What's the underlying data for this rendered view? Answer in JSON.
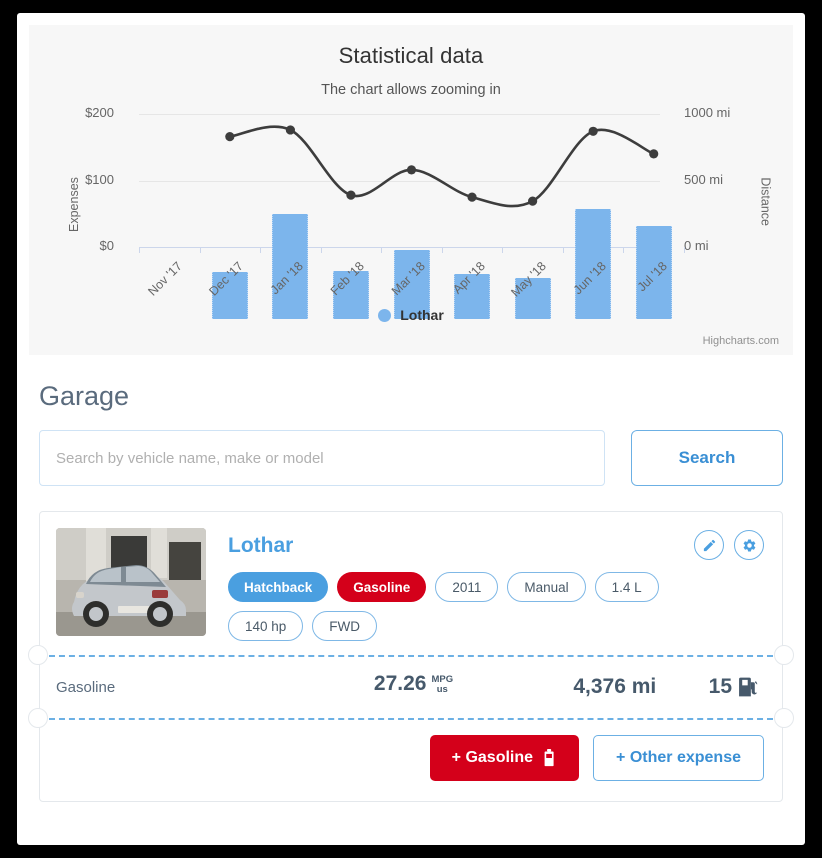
{
  "chart": {
    "title": "Statistical data",
    "subtitle": "The chart allows zooming in",
    "credit": "Highcharts.com",
    "legend_label": "Lothar"
  },
  "chart_data": {
    "type": "bar",
    "title": "Statistical data",
    "subtitle": "The chart allows zooming in",
    "categories": [
      "Nov '17",
      "Dec '17",
      "Jan '18",
      "Feb '18",
      "Mar '18",
      "Apr '18",
      "May '18",
      "Jun '18",
      "Jul '18"
    ],
    "xlabel": "",
    "ylabel": "Expenses",
    "y2label": "Distance",
    "ylim": [
      0,
      200
    ],
    "y2lim": [
      0,
      1000
    ],
    "yticks": [
      "$0",
      "$100",
      "$200"
    ],
    "ytick_values": [
      0,
      100,
      200
    ],
    "y2ticks": [
      "0 mi",
      "500 mi",
      "1000 mi"
    ],
    "y2tick_values": [
      0,
      500,
      1000
    ],
    "grid": true,
    "legend_position": "bottom",
    "series": [
      {
        "name": "Lothar",
        "type": "column",
        "axis": "left",
        "color": "#7cb5ec",
        "values": [
          null,
          70,
          158,
          72,
          104,
          68,
          62,
          165,
          140
        ]
      },
      {
        "name": "Distance",
        "type": "spline",
        "axis": "right",
        "color": "#3d3d3d",
        "values": [
          null,
          830,
          880,
          390,
          580,
          375,
          345,
          870,
          700
        ]
      }
    ]
  },
  "garage": {
    "heading": "Garage",
    "search_placeholder": "Search by vehicle name, make or model",
    "search_value": "",
    "search_button": "Search"
  },
  "vehicle": {
    "name": "Lothar",
    "edit_icon": "pencil-icon",
    "settings_icon": "gear-icon",
    "tags": [
      {
        "label": "Hatchback",
        "style": "filled-blue"
      },
      {
        "label": "Gasoline",
        "style": "filled-red"
      },
      {
        "label": "2011",
        "style": "outline"
      },
      {
        "label": "Manual",
        "style": "outline"
      },
      {
        "label": "1.4 L",
        "style": "outline"
      },
      {
        "label": "140 hp",
        "style": "outline"
      },
      {
        "label": "FWD",
        "style": "outline"
      }
    ],
    "stats": {
      "fuel_type": "Gasoline",
      "consumption_value": "27.26",
      "consumption_unit_top": "MPG",
      "consumption_unit_bottom": "us",
      "distance": "4,376 mi",
      "fillups_count": "15",
      "fillups_icon": "fuel-pump-icon"
    },
    "actions": {
      "add_gasoline": "+ Gasoline",
      "add_other": "+ Other expense"
    }
  },
  "colors": {
    "bar": "#7cb5ec",
    "line": "#3d3d3d",
    "accent_blue": "#4a9fe0",
    "red": "#d4001a",
    "text_slate": "#46596b"
  }
}
